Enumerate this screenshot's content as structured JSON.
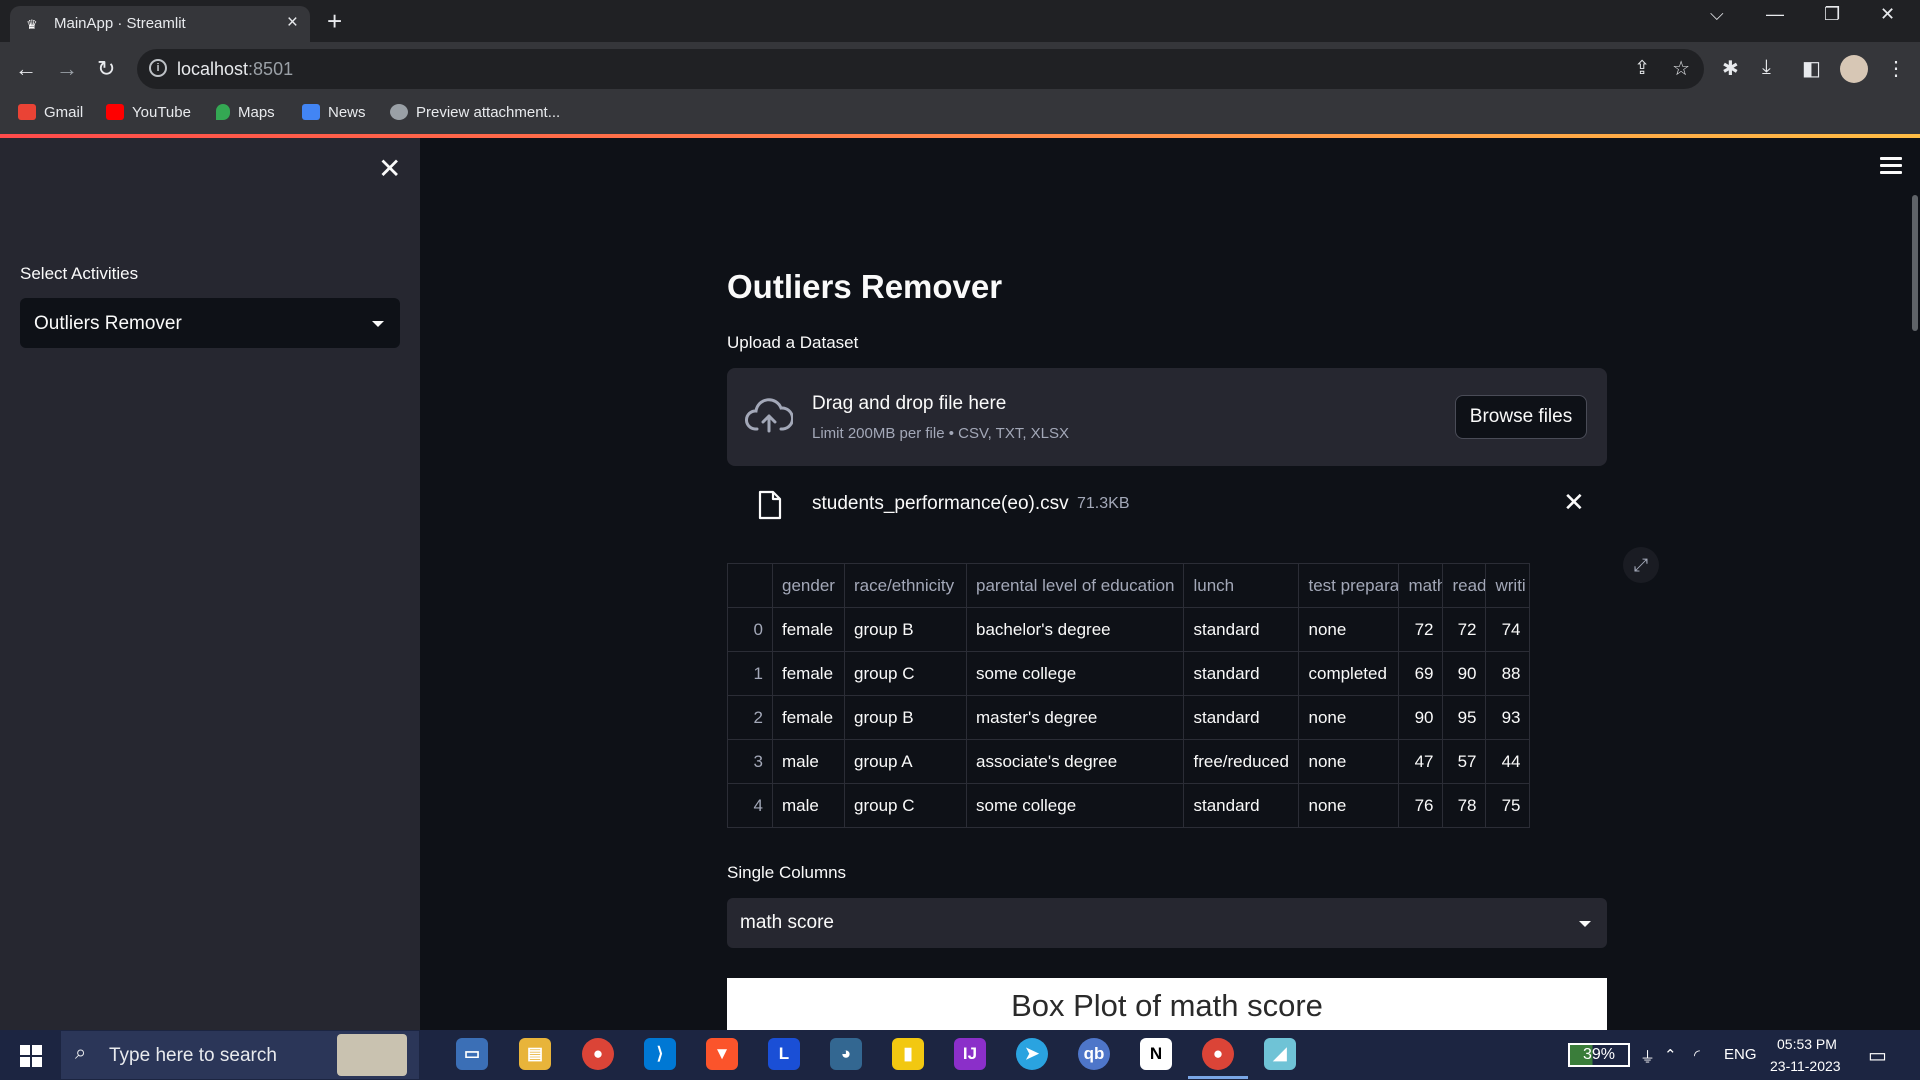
{
  "browser": {
    "tab_title": "MainApp · Streamlit",
    "url_host": "localhost",
    "url_port": ":8501",
    "bookmarks": [
      "Gmail",
      "YouTube",
      "Maps",
      "News",
      "Preview attachment..."
    ]
  },
  "sidebar": {
    "label": "Select Activities",
    "selected": "Outliers Remover"
  },
  "main": {
    "title": "Outliers Remover",
    "upload_label": "Upload a Dataset",
    "dropzone_main": "Drag and drop file here",
    "dropzone_sub": "Limit 200MB per file • CSV, TXT, XLSX",
    "browse_label": "Browse files",
    "file_name": "students_performance(eo).csv",
    "file_size": "71.3KB",
    "table": {
      "headers": [
        "",
        "gender",
        "race/ethnicity",
        "parental level of education",
        "lunch",
        "test prepara",
        "math",
        "read",
        "writi"
      ],
      "rows": [
        [
          "0",
          "female",
          "group B",
          "bachelor's degree",
          "standard",
          "none",
          "72",
          "72",
          "74"
        ],
        [
          "1",
          "female",
          "group C",
          "some college",
          "standard",
          "completed",
          "69",
          "90",
          "88"
        ],
        [
          "2",
          "female",
          "group B",
          "master's degree",
          "standard",
          "none",
          "90",
          "95",
          "93"
        ],
        [
          "3",
          "male",
          "group A",
          "associate's degree",
          "free/reduced",
          "none",
          "47",
          "57",
          "44"
        ],
        [
          "4",
          "male",
          "group C",
          "some college",
          "standard",
          "none",
          "76",
          "78",
          "75"
        ]
      ]
    },
    "single_columns_label": "Single Columns",
    "column_selected": "math score",
    "plot_title": "Box Plot of math score"
  },
  "taskbar": {
    "search_placeholder": "Type here to search",
    "battery": "39%",
    "language": "ENG",
    "time": "05:53 PM",
    "date": "23-11-2023"
  }
}
